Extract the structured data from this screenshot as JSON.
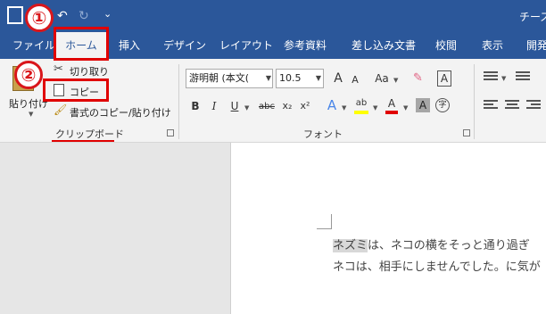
{
  "title_bar": {
    "doc_title": "チーズ"
  },
  "annotations": {
    "step1": "①",
    "step2": "②"
  },
  "tabs": [
    {
      "label": "ファイル"
    },
    {
      "label": "ホーム"
    },
    {
      "label": "挿入"
    },
    {
      "label": "デザイン"
    },
    {
      "label": "レイアウト"
    },
    {
      "label": "参考資料"
    },
    {
      "label": "差し込み文書"
    },
    {
      "label": "校閲"
    },
    {
      "label": "表示"
    },
    {
      "label": "開発"
    }
  ],
  "clipboard": {
    "paste_label": "貼り付け",
    "cut_label": "切り取り",
    "copy_label": "コピー",
    "format_painter_label": "書式のコピー/貼り付け",
    "group_label": "クリップボード"
  },
  "font": {
    "font_name": "游明朝 (本文(",
    "font_size": "10.5",
    "grow_label": "A",
    "shrink_label": "A",
    "case_label": "Aa",
    "border_label": "A",
    "bold_label": "B",
    "italic_label": "I",
    "underline_label": "U",
    "strike_label": "abc",
    "subscript_label": "x₂",
    "superscript_label": "x²",
    "effects_label": "A",
    "highlight_label": "ab",
    "color_label": "A",
    "shade_label": "A",
    "enclose_label": "字",
    "group_label": "フォント"
  },
  "document": {
    "line1_highlight": "ネズミ",
    "line1_rest": "は、ネコの横をそっと通り過ぎ",
    "line2": "ネコは、相手にしませんでした。に気が"
  },
  "colors": {
    "word_blue": "#2b579a",
    "annotation_red": "#e00000",
    "font_color_red": "#e00000",
    "highlight_yellow": "#ffff00"
  }
}
